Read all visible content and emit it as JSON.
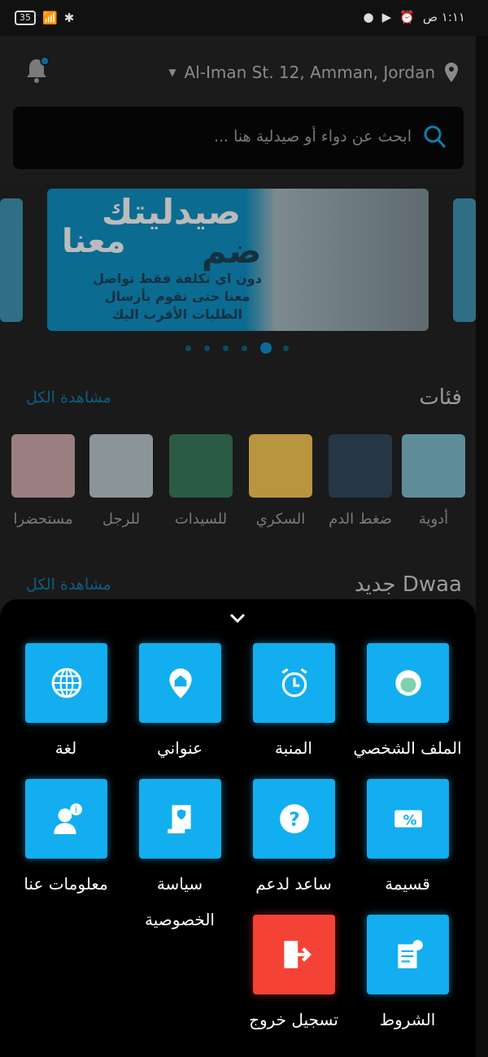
{
  "status_bar": {
    "time": "١:١١ ص",
    "battery": "35",
    "icons": [
      "battery-icon",
      "wifi-icon",
      "signal-icon",
      "bluetooth-icon",
      "alarm-icon",
      "play-store-icon",
      "app-notification-icon"
    ]
  },
  "header": {
    "address": "Al-Iman St. 12, Amman, Jordan",
    "search_placeholder": "ابحث عن دواء أو صيدلية هنا ...",
    "notification_badge": true
  },
  "banner": {
    "headline_1": "صيدليتك",
    "headline_2": "ضم",
    "headline_3": "معنا",
    "body": [
      "دون اي تكلفة فقط تواصل",
      "معنا حتى نقوم بأرسال",
      "الطلبات الأقرب اليك"
    ],
    "page_count": 6,
    "active_page": 5
  },
  "categories": {
    "title": "فئات",
    "see_all": "مشاهدة الكل",
    "items": [
      {
        "label": "أدوية",
        "color": "#5f8c99"
      },
      {
        "label": "ضغط الدم",
        "color": "#253744"
      },
      {
        "label": "السكري",
        "color": "#b8953f"
      },
      {
        "label": "للسيدات",
        "color": "#2b5a45"
      },
      {
        "label": "للرجل",
        "color": "#8b9499"
      },
      {
        "label": "مستحضرا",
        "color": "#9b7f80"
      }
    ]
  },
  "new_section": {
    "title": "جديد Dwaa",
    "see_all": "مشاهدة الكل"
  },
  "menu": {
    "collapse": "chevron-down-icon",
    "accent": "#12aef0",
    "items": [
      {
        "label": "الملف الشخصي",
        "icon": "profile-icon"
      },
      {
        "label": "المنبة",
        "icon": "alarm-clock-icon"
      },
      {
        "label": "عنواني",
        "icon": "location-home-icon"
      },
      {
        "label": "لغة",
        "icon": "globe-icon"
      },
      {
        "label": "قسيمة",
        "icon": "coupon-icon"
      },
      {
        "label": "ساعد لدعم",
        "icon": "help-icon"
      },
      {
        "label": "سياسة الخصوصية",
        "icon": "privacy-policy-icon"
      },
      {
        "label": "معلومات عنا",
        "icon": "about-us-icon"
      },
      {
        "label": "الشروط",
        "icon": "terms-icon"
      },
      {
        "label": "تسجيل خروج",
        "icon": "logout-icon",
        "color": "#f44336"
      }
    ]
  }
}
